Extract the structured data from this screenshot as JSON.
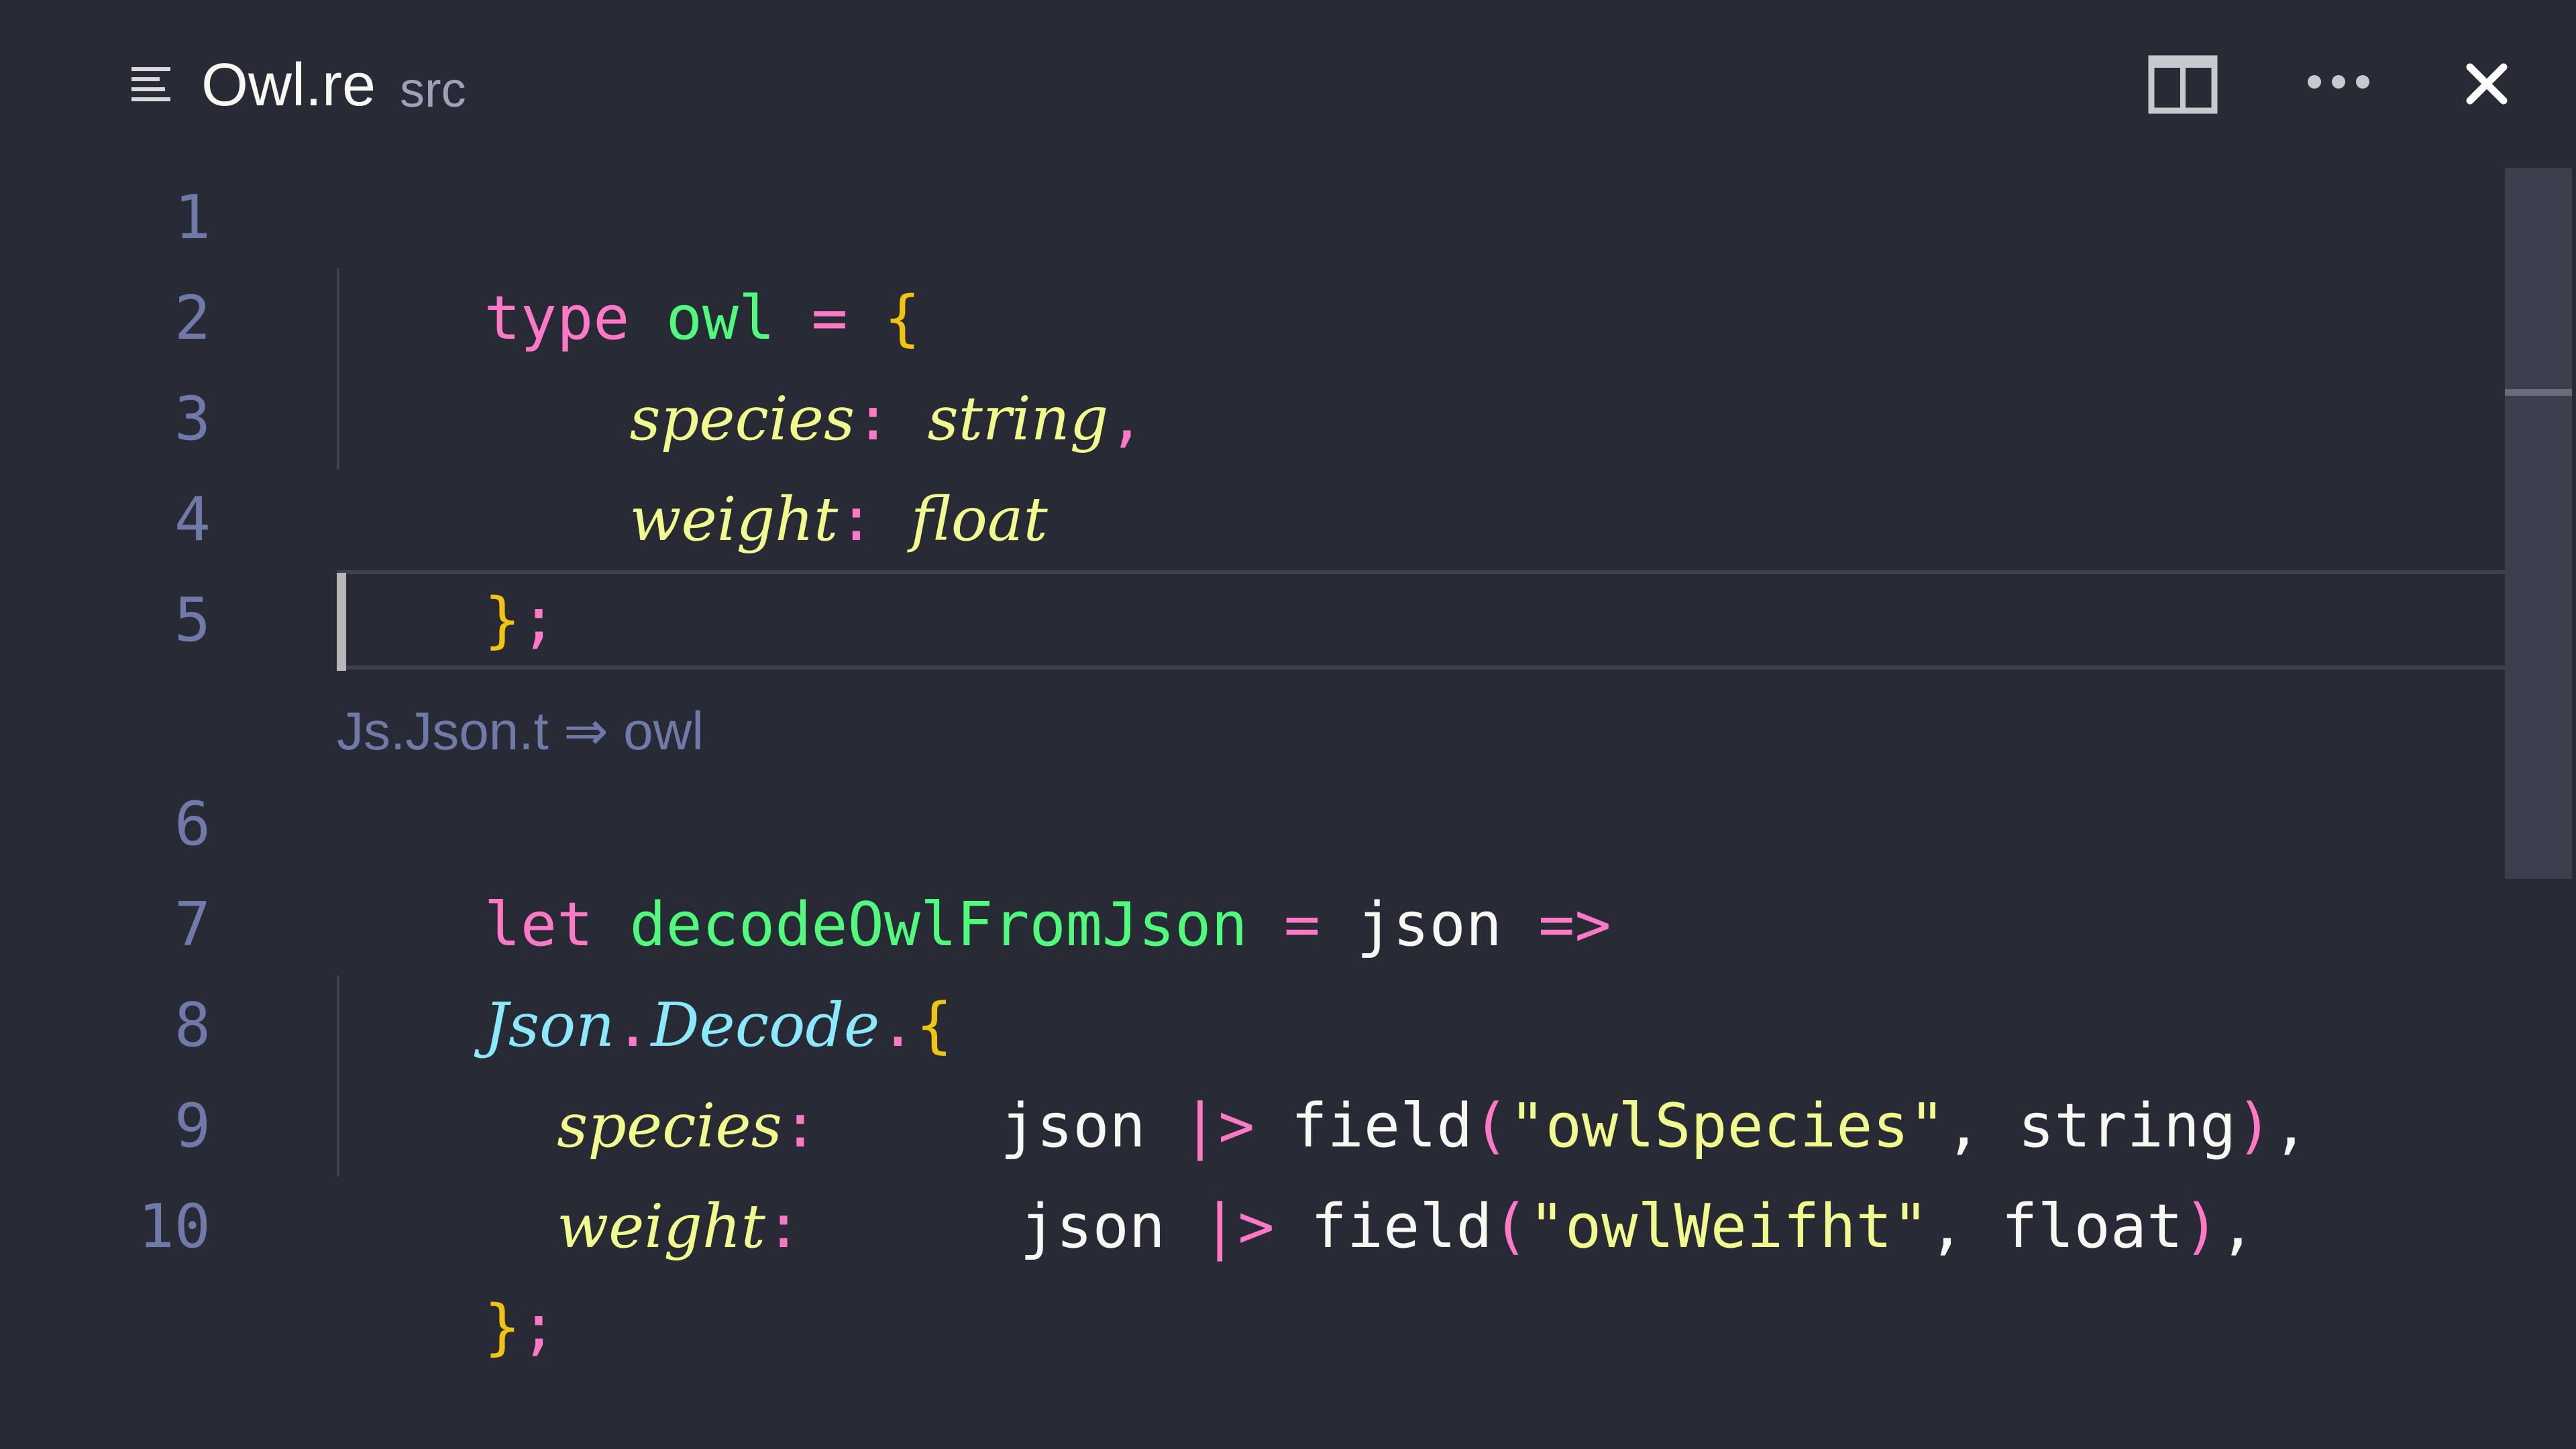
{
  "tab": {
    "title": "Owl.re",
    "path": "src",
    "icons": {
      "outline": "list-outline-icon",
      "split": "split-editor-icon",
      "more": "more-actions-icon",
      "close": "close-icon"
    }
  },
  "editor": {
    "line_numbers": [
      "1",
      "2",
      "3",
      "4",
      "5",
      "6",
      "7",
      "8",
      "9",
      "10"
    ],
    "lines": [
      {
        "tokens": [
          "type",
          " ",
          "owl",
          " ",
          "=",
          " ",
          "{"
        ]
      },
      {
        "tokens": [
          "    ",
          "species",
          ":",
          " ",
          "string",
          ","
        ]
      },
      {
        "tokens": [
          "    ",
          "weight",
          ":",
          " ",
          "float"
        ]
      },
      {
        "tokens": [
          "}",
          ";"
        ]
      },
      {
        "tokens": []
      },
      {
        "tokens": [
          "let",
          " ",
          "decodeOwlFromJson",
          " ",
          "=",
          " ",
          "json",
          " ",
          "=>"
        ]
      },
      {
        "tokens": [
          "Json",
          ".",
          "Decode",
          ".",
          "{"
        ]
      },
      {
        "tokens": [
          "  ",
          "species",
          ":",
          "     ",
          "json",
          " ",
          "|>",
          " ",
          "field",
          "(",
          "\"owlSpecies\"",
          ",",
          " ",
          "string",
          ")",
          ","
        ]
      },
      {
        "tokens": [
          "  ",
          "weight",
          ":",
          "      ",
          "json",
          " ",
          "|>",
          " ",
          "field",
          "(",
          "\"owlWeifht\"",
          ",",
          " ",
          "float",
          ")",
          ","
        ]
      },
      {
        "tokens": [
          "}",
          ";"
        ]
      }
    ],
    "type_hint": "Js.Json.t ⇒ owl",
    "current_line": "5"
  },
  "theme": {
    "background": "#282a36",
    "keyword": "#ff79c6",
    "type_name": "#50fa7b",
    "field": "#f1fa8c",
    "module": "#8be9fd",
    "brace": "#f1c40f",
    "gutter": "#6f7aa8"
  }
}
